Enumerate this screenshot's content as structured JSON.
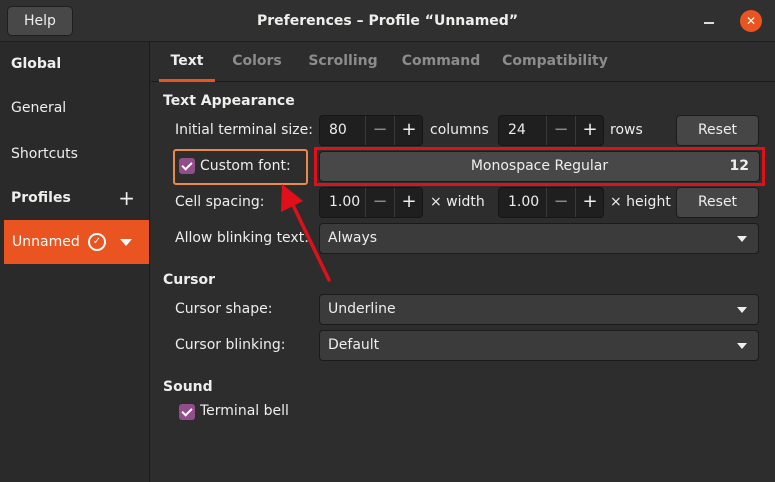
{
  "titlebar": {
    "help_label": "Help",
    "title": "Preferences – Profile “Unnamed”",
    "close_glyph": "✕"
  },
  "sidebar": {
    "global_heading": "Global",
    "general_label": "General",
    "shortcuts_label": "Shortcuts",
    "profiles_heading": "Profiles",
    "add_glyph": "+",
    "profile_name": "Unnamed",
    "default_glyph": "✓"
  },
  "tabs": [
    {
      "label": "Text",
      "active": true
    },
    {
      "label": "Colors",
      "active": false
    },
    {
      "label": "Scrolling",
      "active": false
    },
    {
      "label": "Command",
      "active": false
    },
    {
      "label": "Compatibility",
      "active": false
    }
  ],
  "text_appearance": {
    "heading": "Text Appearance",
    "initial_size_label": "Initial terminal size:",
    "columns_value": "80",
    "columns_label": "columns",
    "rows_value": "24",
    "rows_label": "rows",
    "reset_label": "Reset",
    "custom_font_label": "Custom font:",
    "custom_font_checked": true,
    "font_name": "Monospace Regular",
    "font_size": "12",
    "cell_spacing_label": "Cell spacing:",
    "width_value": "1.00",
    "width_label": "× width",
    "height_value": "1.00",
    "height_label": "× height",
    "reset2_label": "Reset",
    "blink_label": "Allow blinking text:",
    "blink_value": "Always"
  },
  "cursor": {
    "heading": "Cursor",
    "shape_label": "Cursor shape:",
    "shape_value": "Underline",
    "blinking_label": "Cursor blinking:",
    "blinking_value": "Default"
  },
  "sound": {
    "heading": "Sound",
    "bell_label": "Terminal bell",
    "bell_checked": true
  },
  "spin_glyphs": {
    "minus": "−",
    "plus": "+"
  },
  "colors": {
    "accent": "#e95420",
    "checkbox": "#924d8b",
    "annotation": "#e0101a"
  }
}
